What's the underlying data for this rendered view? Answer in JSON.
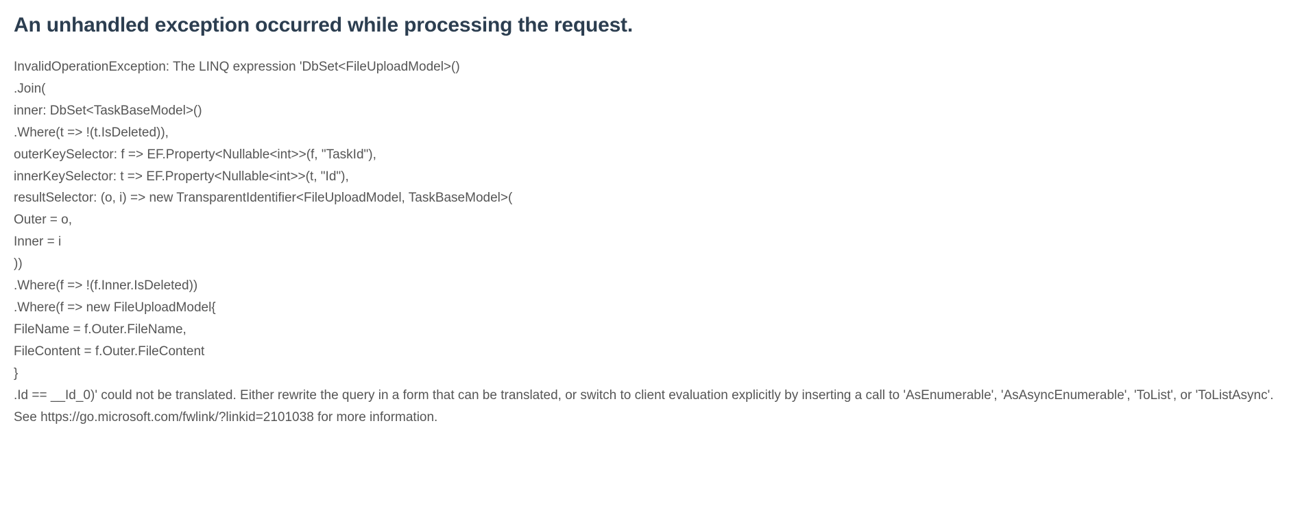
{
  "error": {
    "title": "An unhandled exception occurred while processing the request.",
    "message": "InvalidOperationException: The LINQ expression 'DbSet<FileUploadModel>()\n.Join(\ninner: DbSet<TaskBaseModel>()\n.Where(t => !(t.IsDeleted)),\nouterKeySelector: f => EF.Property<Nullable<int>>(f, \"TaskId\"),\ninnerKeySelector: t => EF.Property<Nullable<int>>(t, \"Id\"),\nresultSelector: (o, i) => new TransparentIdentifier<FileUploadModel, TaskBaseModel>(\nOuter = o,\nInner = i\n))\n.Where(f => !(f.Inner.IsDeleted))\n.Where(f => new FileUploadModel{\nFileName = f.Outer.FileName,\nFileContent = f.Outer.FileContent\n}\n.Id == __Id_0)' could not be translated. Either rewrite the query in a form that can be translated, or switch to client evaluation explicitly by inserting a call to 'AsEnumerable', 'AsAsyncEnumerable', 'ToList', or 'ToListAsync'. See https://go.microsoft.com/fwlink/?linkid=2101038 for more information."
  }
}
